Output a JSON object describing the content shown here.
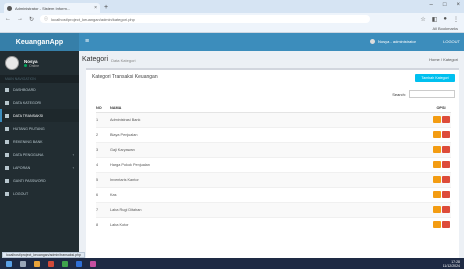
{
  "browser": {
    "tab_title": "Administrator - Sistem Inform...",
    "url": "localhost/project_keuangan/admin/kategori.php",
    "bookmark_all": "All Bookmarks"
  },
  "app": {
    "brand": "KeuanganApp",
    "user_name": "Nosya",
    "user_status": "Online",
    "topbar_user": "Nosya - administrator",
    "logout": "LOGOUT",
    "menu_header": "MAIN NAVIGATION",
    "menu": [
      {
        "label": "DASHBOARD"
      },
      {
        "label": "DATA KATEGORI"
      },
      {
        "label": "DATA TRANSAKSI"
      },
      {
        "label": "HUTANG PIUTANG"
      },
      {
        "label": "REKENING BANK"
      },
      {
        "label": "DATA PENGGUNA"
      },
      {
        "label": "LAPORAN"
      },
      {
        "label": "GANTI PASSWORD"
      },
      {
        "label": "LOGOUT"
      }
    ]
  },
  "page": {
    "title": "Kategori",
    "subtitle": "Data Kategori",
    "crumb": "Home / Kategori",
    "box_title": "Kategori Transaksi Keuangan",
    "add_button": "Tambah Kategori",
    "search_label": "Search:",
    "columns": [
      "NO",
      "NAMA",
      "OPSI"
    ],
    "rows": [
      {
        "no": "1",
        "nama": "Administrasi Bank"
      },
      {
        "no": "2",
        "nama": "Biaya Penjualan"
      },
      {
        "no": "3",
        "nama": "Gaji Karyawan"
      },
      {
        "no": "4",
        "nama": "Harga Pokok Penjualan"
      },
      {
        "no": "5",
        "nama": "Inventaris Kantor"
      },
      {
        "no": "6",
        "nama": "Kas"
      },
      {
        "no": "7",
        "nama": "Laba Rugi Ditahan"
      },
      {
        "no": "8",
        "nama": "Laba Kotor"
      }
    ]
  },
  "status_bar": "localhost/project_keuangan/admin/transaksi.php",
  "clock": {
    "time": "17:28",
    "date": "11/12/2024"
  },
  "colors": {
    "header": "#3c8dbc",
    "sidebar": "#222d32",
    "add": "#00c0ef",
    "edit": "#f39c12",
    "delete": "#dd4b39"
  }
}
